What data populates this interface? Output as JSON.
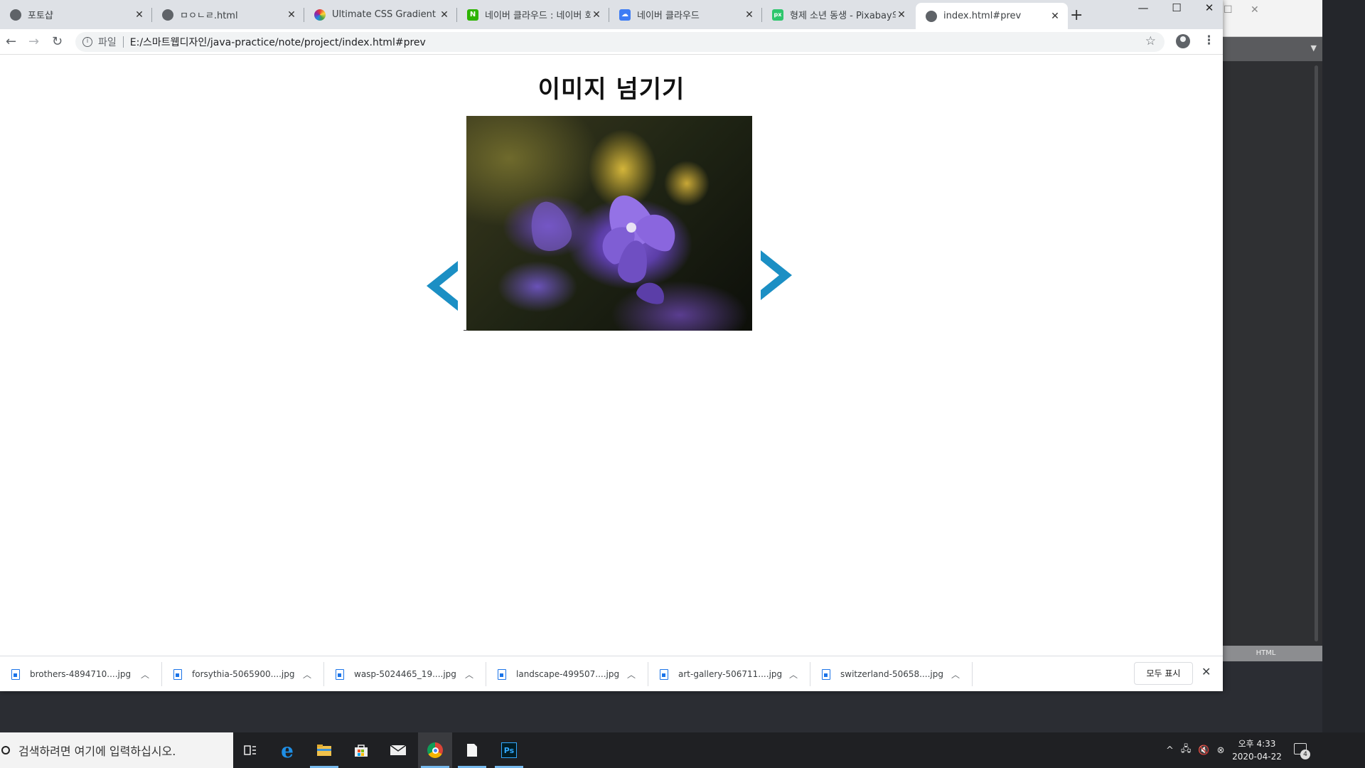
{
  "browser": {
    "tabs": [
      {
        "title": "포토샵",
        "favicon": "globe-icon"
      },
      {
        "title": "ㅁㅇㄴㄹ.html",
        "favicon": "globe-icon"
      },
      {
        "title": "Ultimate CSS Gradient Gen",
        "favicon": "color-wheel-icon"
      },
      {
        "title": "네이버 클라우드 : 네이버 회",
        "favicon": "naver-n-icon"
      },
      {
        "title": "네이버 클라우드",
        "favicon": "naver-cloud-icon"
      },
      {
        "title": "형제 소년 동생 - Pixabay의",
        "favicon": "pixabay-icon"
      },
      {
        "title": "index.html#prev",
        "favicon": "globe-icon",
        "active": true
      }
    ],
    "new_tab_label": "+",
    "address": {
      "scheme_label": "파일",
      "url": "E:/스마트웹디자인/java-practice/note/project/index.html#prev"
    }
  },
  "page": {
    "heading": "이미지 넘기기",
    "prev_arrow": "‹",
    "next_arrow": "›",
    "arrow_color": "#1b8fc4"
  },
  "downloads": {
    "items": [
      {
        "name": "brothers-4894710....jpg"
      },
      {
        "name": "forsythia-5065900....jpg"
      },
      {
        "name": "wasp-5024465_19....jpg"
      },
      {
        "name": "landscape-499507....jpg"
      },
      {
        "name": "art-gallery-506711....jpg"
      },
      {
        "name": "switzerland-50658....jpg"
      }
    ],
    "show_all_label": "모두 표시"
  },
  "editor": {
    "status_label": "HTML"
  },
  "taskbar": {
    "search_placeholder": "검색하려면 여기에 입력하십시오.",
    "clock_time": "오후 4:33",
    "clock_date": "2020-04-22",
    "notification_count": "4"
  }
}
